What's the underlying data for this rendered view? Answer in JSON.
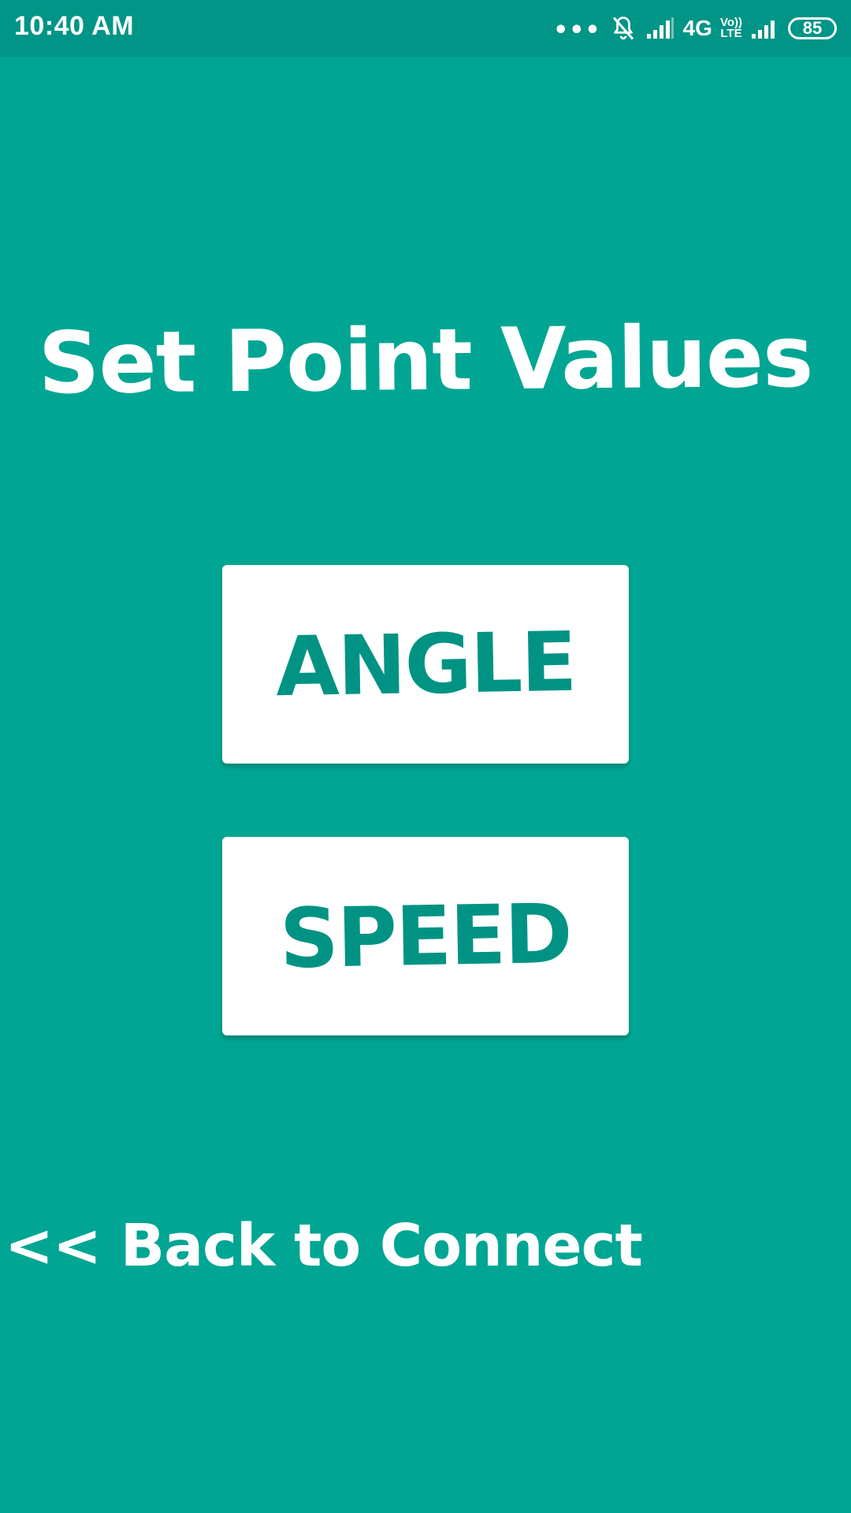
{
  "status_bar": {
    "time": "10:40 AM",
    "dots": "•••",
    "network_type": "4G",
    "volte_top": "Vo))",
    "volte_bottom": "LTE",
    "battery_level": "85",
    "icons": [
      "more-dots-icon",
      "bell-muted-icon",
      "signal-icon",
      "volte-icon",
      "signal-icon-2",
      "battery-icon"
    ]
  },
  "screen": {
    "title": "Set Point Values",
    "buttons": {
      "angle": "ANGLE",
      "speed": "SPEED"
    },
    "back_link": "<< Back to Connect"
  },
  "colors": {
    "background": "#00a693",
    "status_bar": "#009586",
    "button_background": "#ffffff",
    "button_text": "#009384",
    "text_light": "#ffffff"
  }
}
